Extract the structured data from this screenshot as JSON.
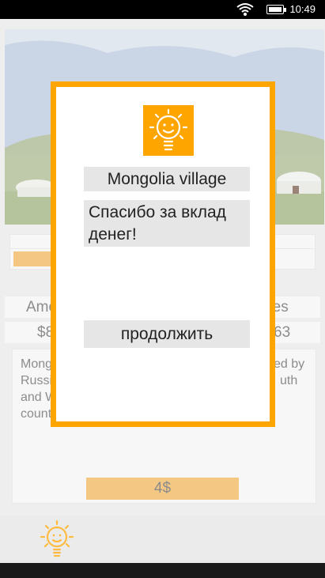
{
  "status_bar": {
    "time": "10:49",
    "wifi_icon": "wifi-icon",
    "battery_icon": "battery-icon"
  },
  "project": {
    "image": "yurts-on-steppe-photo",
    "stat_labels": [
      "Amount",
      "Purchases"
    ],
    "stat_label_visible": [
      "Amo",
      "hases"
    ],
    "stat_values": [
      "$8",
      "63"
    ],
    "description_left": [
      "Mong",
      "Russi",
      "and W",
      "count"
    ],
    "description_right": [
      "ed by",
      "uth"
    ],
    "donate_label": "4$",
    "progress_fraction": 0.23
  },
  "dialog": {
    "icon": "lightbulb-smile-icon",
    "title": "Mongolia village",
    "message": "Спасибо за вклад денег!",
    "continue_label": "продолжить"
  },
  "bottom_bar": {
    "icon": "lightbulb-smile-icon"
  },
  "colors": {
    "accent": "#FFA500",
    "accent_muted": "#F0B55A",
    "panel": "#E6E6E6"
  }
}
